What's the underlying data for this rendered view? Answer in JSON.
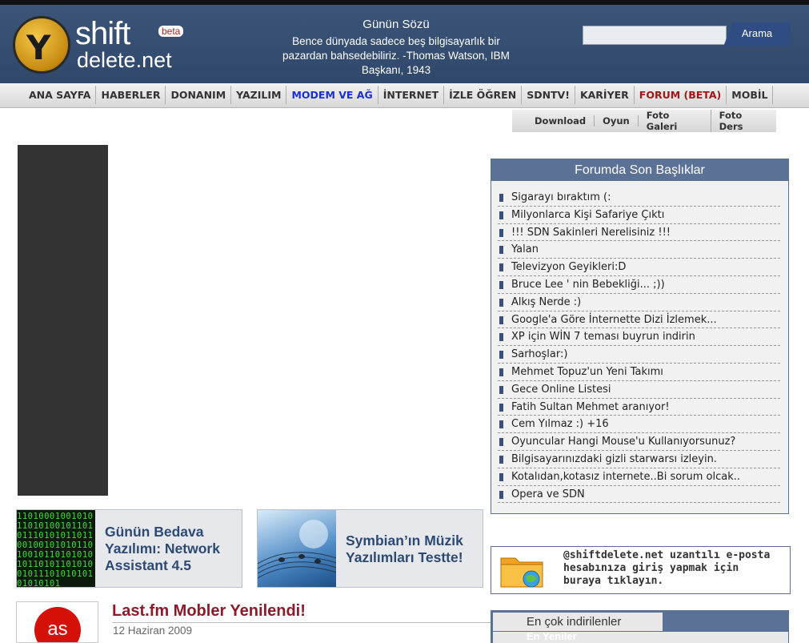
{
  "header": {
    "logo_line1": "shift",
    "logo_line2": "delete.net",
    "logo_badge": "beta",
    "quote_title": "Günün Sözü",
    "quote_text": "Bence dünyada sadece beş bilgisayarlık bir pazardan bahsedebiliriz. -Thomas Watson, IBM Başkanı, 1943",
    "search_button": "Arama"
  },
  "main_nav": [
    {
      "label": "ANA SAYFA"
    },
    {
      "label": "HABERLER"
    },
    {
      "label": "DONANIM"
    },
    {
      "label": "YAZILIM"
    },
    {
      "label": "MODEM VE AĞ"
    },
    {
      "label": "İNTERNET"
    },
    {
      "label": "İZLE ÖĞREN"
    },
    {
      "label": "SDNTV!"
    },
    {
      "label": "KARİYER"
    },
    {
      "label": "FORUM (BETA)"
    },
    {
      "label": "MOBİL"
    }
  ],
  "sub_nav": [
    {
      "label": "Download"
    },
    {
      "label": "Oyun"
    },
    {
      "label": "Foto Galeri"
    },
    {
      "label": "Foto Ders"
    }
  ],
  "forum": {
    "title": "Forumda Son Başlıklar",
    "items": [
      "Sigarayı bıraktım (:",
      "Milyonlarca Kişi Safariye Çıktı",
      "!!! SDN Sakinleri Nerelisiniz !!!",
      "Yalan",
      "Televizyon Geyikleri:D",
      "Bruce Lee ' nin Bebekliği... ;))",
      "Alkış Nerde :)",
      "Google'a Göre İnternette Dizi İzlemek...",
      "XP için WİN 7 teması buyrun indirin",
      "Sarhoşlar:)",
      "Mehmet Topuz'un Yeni Takımı",
      "Gece Online Listesi",
      "Fatih Sultan Mehmet aranıyor!",
      "Cem Yılmaz :) +16",
      "Oyuncular Hangi Mouse'u Kullanıyorsunuz?",
      "Bilgisayarınızdaki gizli starwarsı izleyin.",
      "Kotalıdan,kotasız internete..Bi sorum olcak..",
      "Opera ve SDN"
    ]
  },
  "promos": [
    {
      "title": "Günün Bedava Yazılımı: Network Assistant 4.5",
      "thumb_text": "1101000100101011010100101101011101010110110010010101011010010110101010101101011010100101110101010101010101"
    },
    {
      "title": "Symbian’ın Müzik Yazılımları Testte!"
    }
  ],
  "email_promo": {
    "line1": "@shiftdelete.net uzantılı e-posta",
    "line2": "hesabınıza giriş yapmak için",
    "line3": "buraya tıklayın."
  },
  "news": {
    "title": "Last.fm Mobler Yenilendi!",
    "date": "12 Haziran 2009",
    "thumb_text": "as"
  },
  "downloads": {
    "tab_active": "En çok indirilenler",
    "tab_second": "En Yeniler"
  }
}
